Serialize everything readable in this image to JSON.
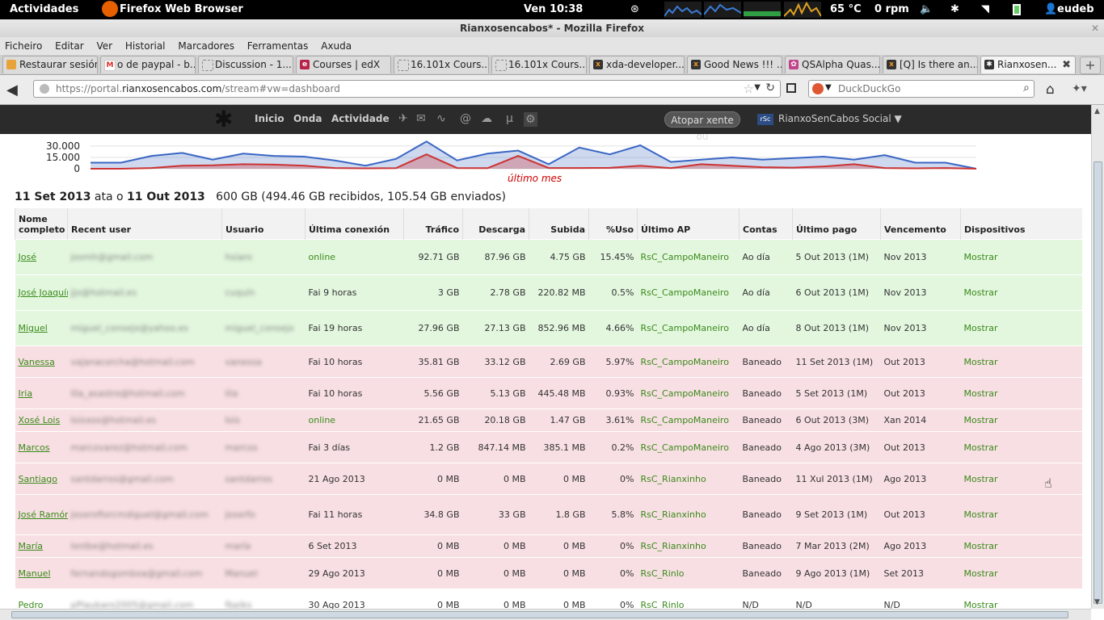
{
  "topbar": {
    "activities": "Actividades",
    "app": "Firefox Web Browser",
    "clock": "Ven 10:38",
    "temp": "65 °C",
    "rpm": "0 rpm",
    "user": "eudeb"
  },
  "window": {
    "title": "Rianxosencabos* - Mozilla Firefox"
  },
  "menu": [
    "Ficheiro",
    "Editar",
    "Ver",
    "Historial",
    "Marcadores",
    "Ferramentas",
    "Axuda"
  ],
  "tabs": [
    {
      "label": "Restaurar sesión",
      "icon": "restore-icon",
      "color": "#e8a33a"
    },
    {
      "label": "o de paypal - b...",
      "icon": "gmail-icon",
      "color": "#d93025"
    },
    {
      "label": "Discussion - 1...",
      "icon": "page-icon",
      "color": "#ffffff"
    },
    {
      "label": "Courses | edX",
      "icon": "edx-icon",
      "color": "#b6244a"
    },
    {
      "label": "16.101x Cours...",
      "icon": "page-icon",
      "color": "#ffffff"
    },
    {
      "label": "16.101x Cours...",
      "icon": "page-icon",
      "color": "#ffffff"
    },
    {
      "label": "xda-developer...",
      "icon": "xda-icon",
      "color": "#f59a23"
    },
    {
      "label": "Good News !!! ...",
      "icon": "xda-icon",
      "color": "#f59a23"
    },
    {
      "label": "QSAlpha Quas...",
      "icon": "qsalpha-icon",
      "color": "#c2448a"
    },
    {
      "label": "[Q] Is there an...",
      "icon": "xda-icon",
      "color": "#f59a23"
    },
    {
      "label": "Rianxosen...",
      "icon": "site-icon",
      "color": "#333333"
    }
  ],
  "nav": {
    "url_prefix": "https://portal.",
    "url_domain": "rianxosencabos.com",
    "url_path": "/stream#vw=dashboard",
    "search_placeholder": "DuckDuckGo"
  },
  "site": {
    "links": [
      "Inicio",
      "Onda",
      "Actividade"
    ],
    "search_label": "Atopar xente ou",
    "brand": "RianxoSenCabos Social ▼",
    "brand_logo": "rSc"
  },
  "chart_data": {
    "type": "area",
    "yticks": [
      "30.000",
      "15.000",
      "0"
    ],
    "ylim": [
      0,
      30000
    ],
    "label": "último mes",
    "series": [
      {
        "color": "#3a66c4",
        "values": [
          8000,
          8000,
          17000,
          21000,
          12000,
          20000,
          17000,
          16000,
          11000,
          4000,
          13000,
          36000,
          11000,
          20000,
          24000,
          6000,
          28000,
          19000,
          31000,
          9000,
          12000,
          15000,
          12000,
          14000,
          16000,
          12000,
          18000,
          8000,
          8000,
          0
        ]
      },
      {
        "color": "#cc3333",
        "values": [
          0,
          0,
          1000,
          4000,
          4500,
          6000,
          5500,
          4000,
          1000,
          500,
          800,
          19000,
          1000,
          800,
          17000,
          1000,
          1000,
          1200,
          4000,
          800,
          6000,
          4000,
          2000,
          1500,
          3000,
          6000,
          1000,
          500,
          1000,
          0
        ]
      }
    ]
  },
  "period": {
    "start": "11 Set 2013",
    "mid": " ata o ",
    "end": "11 Out 2013",
    "summary": "600 GB (494.46 GB recibidos, 105.54 GB enviados)"
  },
  "table": {
    "headers": [
      "Nome completo",
      "Recent user",
      "Usuario",
      "Última conexión",
      "Tráfico",
      "Descarga",
      "Subida",
      "%Uso",
      "Último AP",
      "Contas",
      "Último pago",
      "Vencemento",
      "Dispositivos"
    ],
    "rows": [
      {
        "status": "ok",
        "name": "José",
        "email": "josmh@gmail.com",
        "user": "hsiaro",
        "last": "online",
        "traffic": "92.71 GB",
        "down": "87.96 GB",
        "up": "4.75 GB",
        "pct": "15.45%",
        "ap": "RsC_CampoManeiro",
        "account": "Ao día",
        "paid": "5 Out 2013 (1M)",
        "due": "Nov 2013",
        "dev": "Mostrar",
        "h": 44
      },
      {
        "status": "ok",
        "name": "José Joaquín",
        "email": "jjo@hotmail.es",
        "user": "cuquín",
        "last": "Fai 9 horas",
        "traffic": "3 GB",
        "down": "2.78 GB",
        "up": "220.82 MB",
        "pct": "0.5%",
        "ap": "RsC_CampoManeiro",
        "account": "Ao día",
        "paid": "6 Out 2013 (1M)",
        "due": "Nov 2013",
        "dev": "Mostrar",
        "h": 44
      },
      {
        "status": "ok",
        "name": "Miguel",
        "email": "miguel_consejo@yahoo.es",
        "user": "miguel_consejo",
        "last": "Fai 19 horas",
        "traffic": "27.96 GB",
        "down": "27.13 GB",
        "up": "852.96 MB",
        "pct": "4.66%",
        "ap": "RsC_CampoManeiro",
        "account": "Ao día",
        "paid": "8 Out 2013 (1M)",
        "due": "Nov 2013",
        "dev": "Mostrar",
        "h": 44
      },
      {
        "status": "ban",
        "name": "Vanessa",
        "email": "vajanacorcha@hotmail.com",
        "user": "vanessa",
        "last": "Fai 10 horas",
        "traffic": "35.81 GB",
        "down": "33.12 GB",
        "up": "2.69 GB",
        "pct": "5.97%",
        "ap": "RsC_CampoManeiro",
        "account": "Baneado",
        "paid": "11 Set 2013 (1M)",
        "due": "Out 2013",
        "dev": "Mostrar",
        "h": 39
      },
      {
        "status": "ban",
        "name": "Iria",
        "email": "lila_asastro@hotmail.com",
        "user": "lila",
        "last": "Fai 10 horas",
        "traffic": "5.56 GB",
        "down": "5.13 GB",
        "up": "445.48 MB",
        "pct": "0.93%",
        "ap": "RsC_CampoManeiro",
        "account": "Baneado",
        "paid": "5 Set 2013 (1M)",
        "due": "Out 2013",
        "dev": "Mostrar",
        "h": 39
      },
      {
        "status": "ban",
        "name": "Xosé Lois",
        "email": "loisxos@hotmail.es",
        "user": "lois",
        "last": "online",
        "traffic": "21.65 GB",
        "down": "20.18 GB",
        "up": "1.47 GB",
        "pct": "3.61%",
        "ap": "RsC_CampoManeiro",
        "account": "Baneado",
        "paid": "6 Out 2013 (3M)",
        "due": "Xan 2014",
        "dev": "Mostrar",
        "h": 28
      },
      {
        "status": "ban",
        "name": "Marcos",
        "email": "marcovarez@hotmail.com",
        "user": "marcos",
        "last": "Fai 3 días",
        "traffic": "1.2 GB",
        "down": "847.14 MB",
        "up": "385.1 MB",
        "pct": "0.2%",
        "ap": "RsC_CampoManeiro",
        "account": "Baneado",
        "paid": "4 Ago 2013 (3M)",
        "due": "Out 2013",
        "dev": "Mostrar",
        "h": 39
      },
      {
        "status": "ban",
        "name": "Santiago",
        "email": "santdarros@gmail.com",
        "user": "santdarros",
        "last": "21 Ago 2013",
        "traffic": "0 MB",
        "down": "0 MB",
        "up": "0 MB",
        "pct": "0%",
        "ap": "RsC_Rianxinho",
        "account": "Baneado",
        "paid": "11 Xul 2013 (1M)",
        "due": "Ago 2013",
        "dev": "Mostrar",
        "h": 39
      },
      {
        "status": "ban",
        "name": "José Ramón",
        "email": "joseroflorcmdiguel@gmail.com",
        "user": "joserfo",
        "last": "Fai 11 horas",
        "traffic": "34.8 GB",
        "down": "33 GB",
        "up": "1.8 GB",
        "pct": "5.8%",
        "ap": "RsC_Rianxinho",
        "account": "Baneado",
        "paid": "9 Set 2013 (1M)",
        "due": "Out 2013",
        "dev": "Mostrar",
        "h": 50
      },
      {
        "status": "ban",
        "name": "María",
        "email": "lonlbe@hotmail.es",
        "user": "maría",
        "last": "6 Set 2013",
        "traffic": "0 MB",
        "down": "0 MB",
        "up": "0 MB",
        "pct": "0%",
        "ap": "RsC_Rianxinho",
        "account": "Baneado",
        "paid": "7 Mar 2013 (2M)",
        "due": "Ago 2013",
        "dev": "Mostrar",
        "h": 28
      },
      {
        "status": "ban",
        "name": "Manuel",
        "email": "fernandogomboa@gmail.com",
        "user": "Manuel",
        "last": "29 Ago 2013",
        "traffic": "0 MB",
        "down": "0 MB",
        "up": "0 MB",
        "pct": "0%",
        "ap": "RsC_Rinlo",
        "account": "Baneado",
        "paid": "9 Ago 2013 (1M)",
        "due": "Set 2013",
        "dev": "Mostrar",
        "h": 39
      },
      {
        "status": "none",
        "name": "Pedro",
        "email": "pPlaubaro2005@gmail.com",
        "user": "fbplks",
        "last": "30 Ago 2013",
        "traffic": "0 MB",
        "down": "0 MB",
        "up": "0 MB",
        "pct": "0%",
        "ap": "RsC_Rinlo",
        "account": "N/D",
        "paid": "N/D",
        "due": "N/D",
        "dev": "Mostrar",
        "h": 39
      }
    ]
  }
}
